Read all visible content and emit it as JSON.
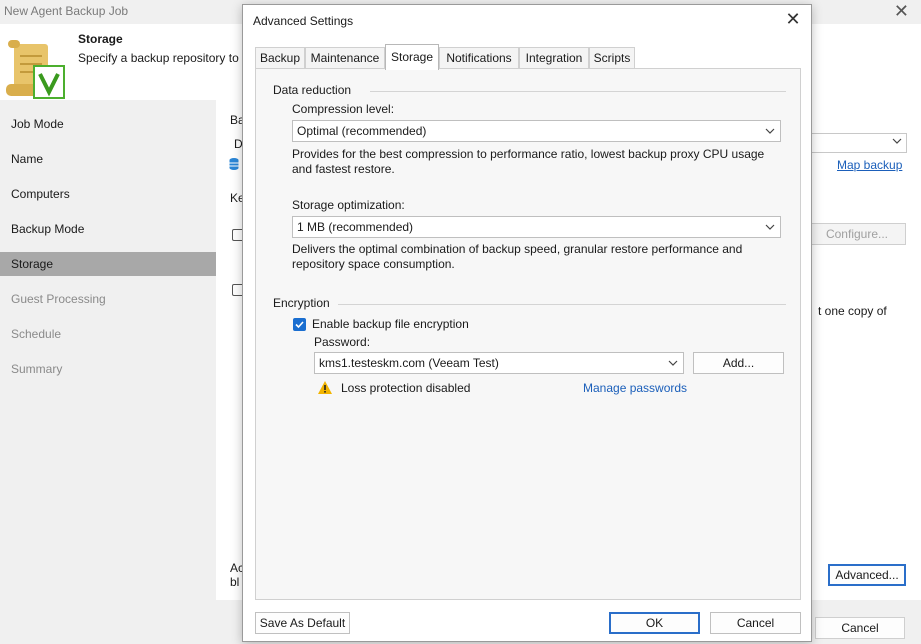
{
  "wizard": {
    "title": "New Agent Backup Job",
    "header_title": "Storage",
    "header_desc": "Specify a backup repository to s",
    "sidebar": [
      {
        "label": "Job Mode",
        "state": "normal"
      },
      {
        "label": "Name",
        "state": "normal"
      },
      {
        "label": "Computers",
        "state": "normal"
      },
      {
        "label": "Backup Mode",
        "state": "normal"
      },
      {
        "label": "Storage",
        "state": "active"
      },
      {
        "label": "Guest Processing",
        "state": "disabled"
      },
      {
        "label": "Schedule",
        "state": "disabled"
      },
      {
        "label": "Summary",
        "state": "disabled"
      }
    ],
    "fragments": {
      "ba": "Ba",
      "d": "D",
      "ke": "Ke",
      "one_copy": "t one copy of",
      "ac": "Ac",
      "bl": "bl"
    },
    "map_backup": "Map backup",
    "configure": "Configure...",
    "advanced": "Advanced...",
    "cancel": "Cancel"
  },
  "dialog": {
    "title": "Advanced Settings",
    "tabs": [
      "Backup",
      "Maintenance",
      "Storage",
      "Notifications",
      "Integration",
      "Scripts"
    ],
    "active_tab": "Storage",
    "data_reduction": {
      "heading": "Data reduction",
      "compression_label": "Compression level:",
      "compression_value": "Optimal (recommended)",
      "compression_desc": "Provides for the best compression to performance ratio, lowest backup proxy CPU usage and fastest restore.",
      "optimization_label": "Storage optimization:",
      "optimization_value": "1 MB (recommended)",
      "optimization_desc": "Delivers the optimal combination of backup speed, granular restore performance and repository space consumption."
    },
    "encryption": {
      "heading": "Encryption",
      "enable_label": "Enable backup file encryption",
      "enabled": true,
      "password_label": "Password:",
      "password_value": "kms1.testeskm.com (Veeam Test)",
      "add_button": "Add...",
      "warning_text": "Loss protection disabled",
      "manage_link": "Manage passwords"
    },
    "buttons": {
      "save_default": "Save As Default",
      "ok": "OK",
      "cancel": "Cancel"
    }
  },
  "colors": {
    "accent": "#1a6ed0",
    "link": "#1b5fba",
    "warning": "#f2b400",
    "active_sidebar": "#a8a8a8"
  }
}
